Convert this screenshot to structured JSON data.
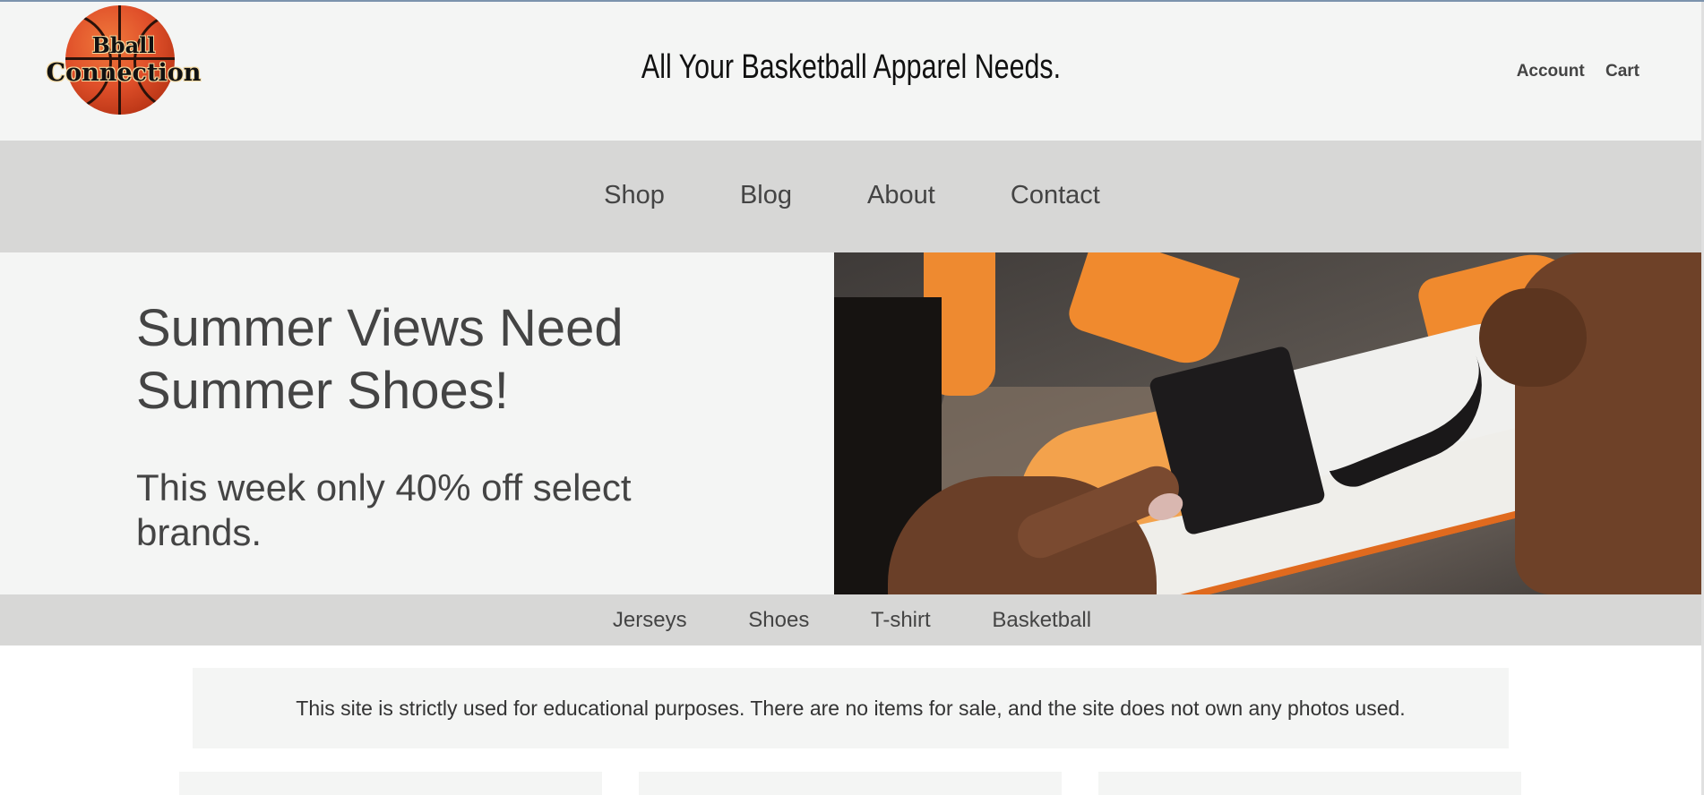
{
  "brand": {
    "logo_line1": "Bball",
    "logo_line2": "Connection"
  },
  "header": {
    "tagline": "All Your Basketball Apparel Needs.",
    "links": [
      "Account",
      "Cart"
    ]
  },
  "main_nav": [
    "Shop",
    "Blog",
    "About",
    "Contact"
  ],
  "hero": {
    "title_line1": "Summer Views Need",
    "title_line2": "Summer Shoes!",
    "subtitle": "This week only 40% off select brands.",
    "image_description_icon": "sneaker-photo"
  },
  "category_nav": [
    "Jerseys",
    "Shoes",
    "T-shirt",
    "Basketball"
  ],
  "notice": {
    "text": "This site is strictly used for educational purposes. There are no items for sale, and the site does not own any photos used."
  },
  "colors": {
    "header_bg": "#f4f5f4",
    "nav_bg": "#d7d7d6",
    "text": "#444444",
    "accent_orange": "#f08a2e"
  }
}
